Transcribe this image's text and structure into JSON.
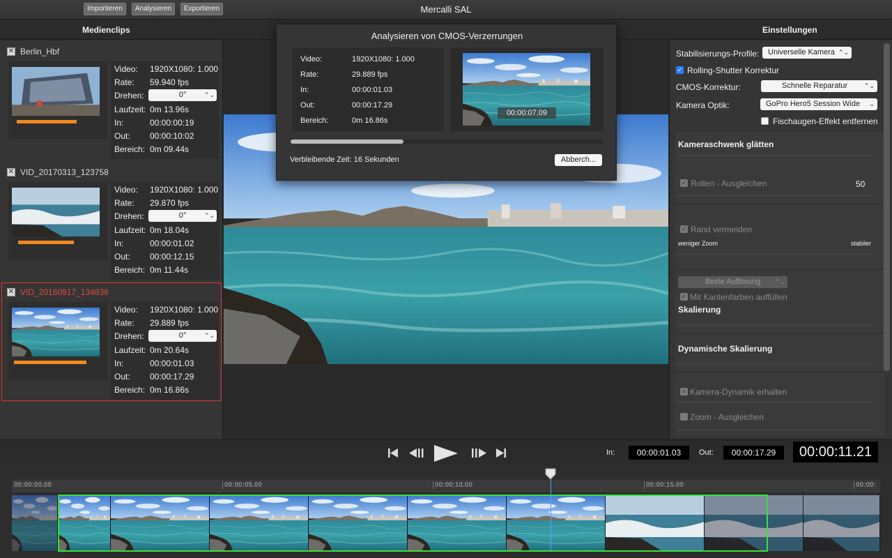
{
  "app": {
    "title": "Mercalli SAL"
  },
  "toolbar": {
    "import": "Importieren",
    "analyze": "Analysieren",
    "export": "Exportieren"
  },
  "panels": {
    "clips_header": "Medienclips",
    "settings_header": "Einstellungen"
  },
  "labels": {
    "video": "Video:",
    "rate": "Rate:",
    "rotate": "Drehen:",
    "duration": "Laufzeit:",
    "in": "In:",
    "out": "Out:",
    "range": "Bereich:"
  },
  "clips": [
    {
      "name": "Berlin_Hbf",
      "video": "1920X1080: 1.000",
      "rate": "59.940 fps",
      "rotate": "0°",
      "duration": "0m 13.96s",
      "in": "00:00:00:19",
      "out": "00:00:10:02",
      "range": "0m 09.44s",
      "checked": "✕"
    },
    {
      "name": "VID_20170313_123758",
      "video": "1920X1080: 1.000",
      "rate": "29.870 fps",
      "rotate": "0°",
      "duration": "0m 18.04s",
      "in": "00:00:01.02",
      "out": "00:00:12.15",
      "range": "0m 11.44s",
      "checked": "✕"
    },
    {
      "name": "VID_20160917_134836",
      "video": "1920X1080: 1.000",
      "rate": "29.889 fps",
      "rotate": "0°",
      "duration": "0m 20.64s",
      "in": "00:00:01.03",
      "out": "00:00:17.29",
      "range": "0m 16.86s",
      "checked": "✕"
    }
  ],
  "dialog": {
    "title": "Analysieren von CMOS-Verzerrungen",
    "video_label": "Video:",
    "video": "1920X1080: 1.000",
    "rate_label": "Rate:",
    "rate": "29.889 fps",
    "in_label": "In:",
    "in": "00:00:01.03",
    "out_label": "Out:",
    "out": "00:00:17.29",
    "range_label": "Bereich:",
    "range": "0m 16.86s",
    "preview_timecode": "00:00:07.09",
    "progress": 0.36,
    "remaining": "Verbleibende Zeit: 16 Sekunden",
    "cancel": "Abberch..."
  },
  "settings": {
    "profile_label": "Stabilisierungs-Profile:",
    "profile_value": "Universelle Kamera",
    "rolling_shutter": "Rolling-Shutter Korrektur",
    "cmos_label": "CMOS-Korrektur:",
    "cmos_value": "Schnelle Reparatur",
    "optics_label": "Kamera Optik:",
    "optics_value": "GoPro Hero5 Session Wide",
    "fisheye": "Fischaugen-Effekt entfernen",
    "pan_title": "Kameraschwenk glätten",
    "roll": "Rollen - Ausgleichen",
    "roll_value": "50",
    "border": "Rand vermeiden",
    "less_zoom": "weniger Zoom",
    "more_stable": "stabiler",
    "resolution": "Beste Auflösung",
    "edge_fill": "Mit Kantenfarben auffüllen",
    "scaling_title": "Skalierung",
    "dyn_scaling_title": "Dynamische Skalierung",
    "keep_dynamics": "Kamera-Dynamik erhalten",
    "zoom": "Zoom - Ausgleichen"
  },
  "transport": {
    "in_label": "In:",
    "in_value": "00:00:01.03",
    "out_label": "Out:",
    "out_value": "00:00:17.29",
    "current": "00:00:11.21"
  },
  "timeline": {
    "ticks": [
      "00:00:00.00",
      "00:00:05.00",
      "00:00:10.00",
      "00:00:15.00",
      "00:00:"
    ]
  },
  "colors": {
    "accent_orange": "#f28a1e",
    "selection_red": "#d23a32",
    "range_green": "#37e236",
    "checkbox_blue": "#2d7df6"
  }
}
